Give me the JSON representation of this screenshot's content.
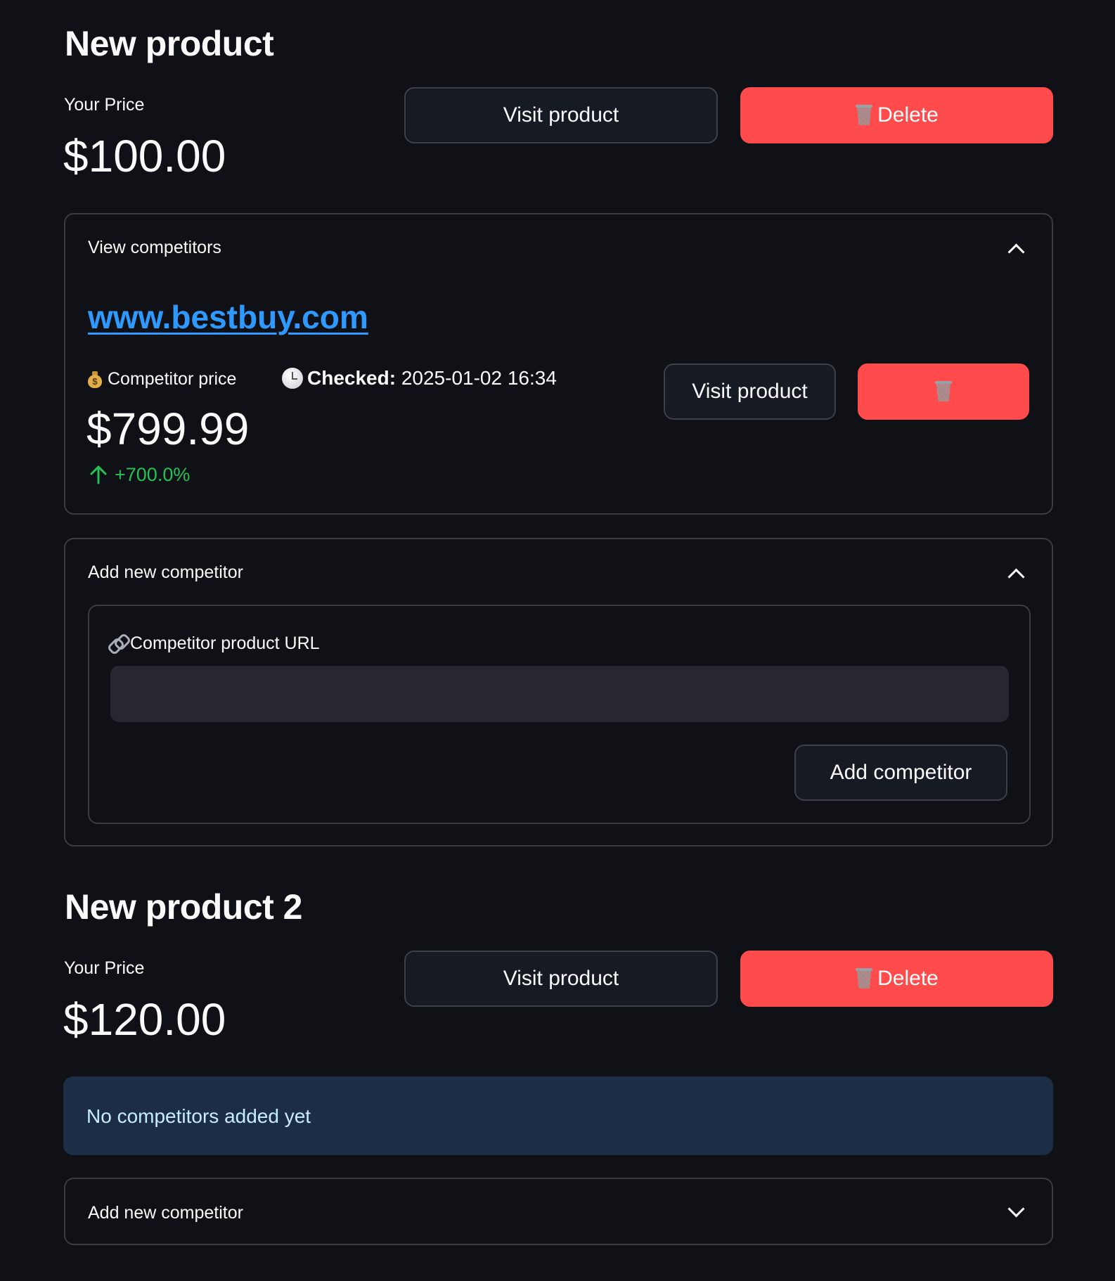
{
  "products": [
    {
      "title": "New product",
      "price_label": "Your Price",
      "price_value": "$100.00",
      "visit_label": "Visit product",
      "delete_label": "Delete",
      "competitors_expander": {
        "title": "View competitors",
        "state": "expanded",
        "competitors": [
          {
            "site": "www.bestbuy.com",
            "price_label": "Competitor price",
            "price_value": "$799.99",
            "delta": "+700.0%",
            "checked_label": "Checked:",
            "checked_value": "2025-01-02 16:34",
            "visit_label": "Visit product"
          }
        ]
      },
      "add_expander": {
        "title": "Add new competitor",
        "state": "expanded",
        "url_label": "Competitor product URL",
        "url_value": "",
        "submit_label": "Add competitor"
      }
    },
    {
      "title": "New product 2",
      "price_label": "Your Price",
      "price_value": "$120.00",
      "visit_label": "Visit product",
      "delete_label": "Delete",
      "empty_message": "No competitors added yet",
      "add_expander": {
        "title": "Add new competitor",
        "state": "collapsed"
      }
    }
  ],
  "icons": {
    "delete": "wastebasket-icon",
    "competitor_price": "money-bag-icon",
    "checked": "clock-icon",
    "url": "link-icon",
    "delta": "arrow-up-icon",
    "expanded": "chevron-up-icon",
    "collapsed": "chevron-down-icon"
  },
  "colors": {
    "background": "#0f1117",
    "primary": "#ff4b4b",
    "link": "#2e9aff",
    "positive": "#21c354",
    "info_bg": "#1c2e45",
    "info_text": "#c7ebff"
  }
}
